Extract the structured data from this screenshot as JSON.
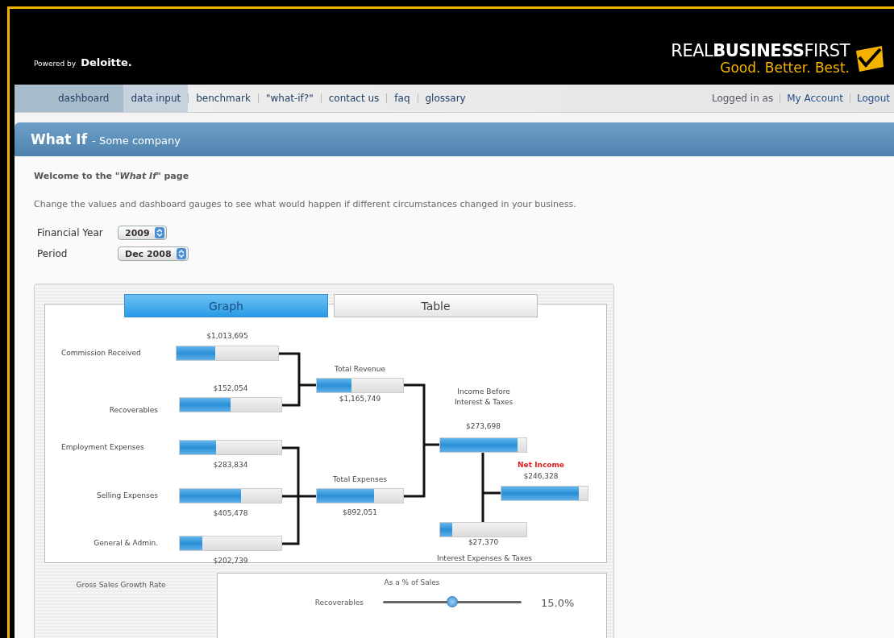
{
  "header": {
    "powered_by": "Powered by",
    "brand": "Deloitte.",
    "logo": "REAL**BUSINESS**FIRST",
    "tagline": "Good. Better. Best."
  },
  "nav": {
    "tabs": [
      {
        "label": "dashboard",
        "selected": false
      },
      {
        "label": "data input",
        "selected": true
      },
      {
        "label": "benchmark",
        "selected": false
      },
      {
        "label": "\"what-if?\"",
        "selected": false
      },
      {
        "label": "contact us",
        "selected": false
      },
      {
        "label": "faq",
        "selected": false
      },
      {
        "label": "glossary",
        "selected": false
      }
    ],
    "account": {
      "status": "Logged in as",
      "links": [
        "My Account",
        "Logout"
      ]
    }
  },
  "page_title": {
    "title": "What If",
    "subtitle": "- Some company"
  },
  "intro": {
    "heading": "Welcome to the *\"What If\"* page",
    "text": "Change the values and dashboard gauges to see what would happen if different circumstances changed in your business."
  },
  "filters": [
    {
      "label": "Financial Year",
      "value": "2009"
    },
    {
      "label": "Period",
      "value": "Dec 2008"
    }
  ],
  "view_tabs": [
    {
      "label": "Graph",
      "selected": true
    },
    {
      "label": "Table",
      "selected": false
    }
  ],
  "nodes": [
    {
      "label": "Commission Received",
      "value": "$1,013,695",
      "level": 0.38,
      "highlight": false
    },
    {
      "label": "Recoverables",
      "value": "$152,054",
      "level": 0.5,
      "highlight": false
    },
    {
      "label": "Employment Expenses",
      "value": "$283,834",
      "level": 0.36,
      "highlight": false
    },
    {
      "label": "Selling Expenses",
      "value": "$405,478",
      "level": 0.6,
      "highlight": false
    },
    {
      "label": "General & Admin.",
      "value": "$202,739",
      "level": 0.22,
      "highlight": false
    },
    {
      "label": "Total Revenue",
      "value": "$1,165,749",
      "level": 0.4,
      "highlight": false
    },
    {
      "label": "Total Expenses",
      "value": "$892,051",
      "level": 0.66,
      "highlight": false
    },
    {
      "label": "Income Before Interest & Taxes",
      "value": "$273,698",
      "level": 0.9,
      "highlight": false
    },
    {
      "label": "Net Income",
      "value": "$246,328",
      "level": 0.9,
      "highlight": true
    },
    {
      "label": "Interest Expenses & Taxes",
      "value": "$27,370",
      "level": 0.14,
      "highlight": false
    }
  ],
  "growth": {
    "title": "Gross Sales Growth Rate"
  },
  "sales_share": {
    "title": "As a % of Sales",
    "sliders": [
      {
        "label": "Recoverables",
        "level": 0.5,
        "reading": "15.0%"
      }
    ]
  }
}
